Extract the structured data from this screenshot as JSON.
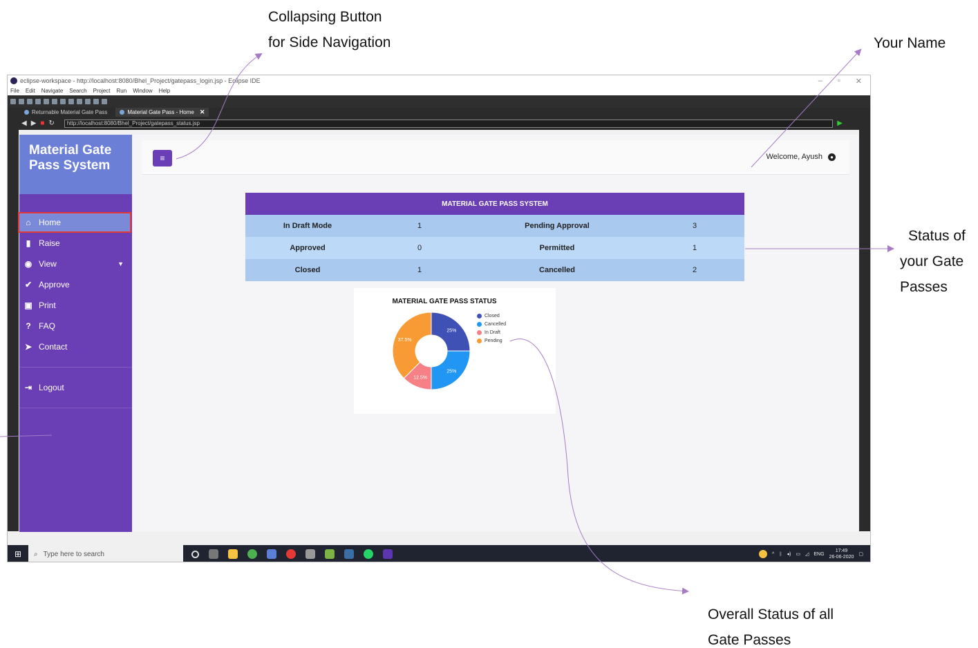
{
  "annotations": {
    "collapse_line1": "Collapsing Button",
    "collapse_line2": "for Side Navigation",
    "your_name": "Your Name",
    "status_line1": "Status of",
    "status_line2": "your Gate",
    "status_line3": "Passes",
    "overall_line1": "Overall Status of all",
    "overall_line2": "Gate  Passes"
  },
  "window": {
    "title": "eclipse-workspace - http://localhost:8080/Bhel_Project/gatepass_login.jsp - Eclipse IDE",
    "menu": [
      "File",
      "Edit",
      "Navigate",
      "Search",
      "Project",
      "Run",
      "Window",
      "Help"
    ],
    "tabs": [
      "Returnable Material Gate Pass",
      "Material Gate Pass - Home"
    ],
    "url": "http://localhost:8080/Bhel_Project/gatepass_status.jsp"
  },
  "sidebar": {
    "brand": "Material Gate Pass System",
    "items": [
      {
        "label": "Home",
        "icon": "home-icon"
      },
      {
        "label": "Raise",
        "icon": "file-icon"
      },
      {
        "label": "View",
        "icon": "eye-icon"
      },
      {
        "label": "Approve",
        "icon": "check-icon"
      },
      {
        "label": "Print",
        "icon": "print-icon"
      },
      {
        "label": "FAQ",
        "icon": "question-icon"
      },
      {
        "label": "Contact",
        "icon": "send-icon"
      }
    ],
    "logout": "Logout"
  },
  "topbar": {
    "welcome": "Welcome, Ayush"
  },
  "status_table": {
    "header": "MATERIAL GATE PASS SYSTEM",
    "rows": [
      {
        "label1": "In Draft Mode",
        "value1": "1",
        "label2": "Pending Approval",
        "value2": "3"
      },
      {
        "label1": "Approved",
        "value1": "0",
        "label2": "Permitted",
        "value2": "1"
      },
      {
        "label1": "Closed",
        "value1": "1",
        "label2": "Cancelled",
        "value2": "2"
      }
    ]
  },
  "chart_data": {
    "type": "pie",
    "title": "MATERIAL GATE PASS STATUS",
    "categories": [
      "Closed",
      "Cancelled",
      "In Draft",
      "Pending"
    ],
    "values": [
      25,
      25,
      12.5,
      37.5
    ],
    "labels": [
      "25%",
      "25%",
      "12.5%",
      "37.5%"
    ],
    "colors": [
      "#3f51b5",
      "#2196f3",
      "#f77f86",
      "#f99b34"
    ],
    "legend": "right"
  },
  "taskbar": {
    "search_placeholder": "Type here to search",
    "lang": "ENG",
    "time": "17:49",
    "date": "26-06-2020"
  }
}
